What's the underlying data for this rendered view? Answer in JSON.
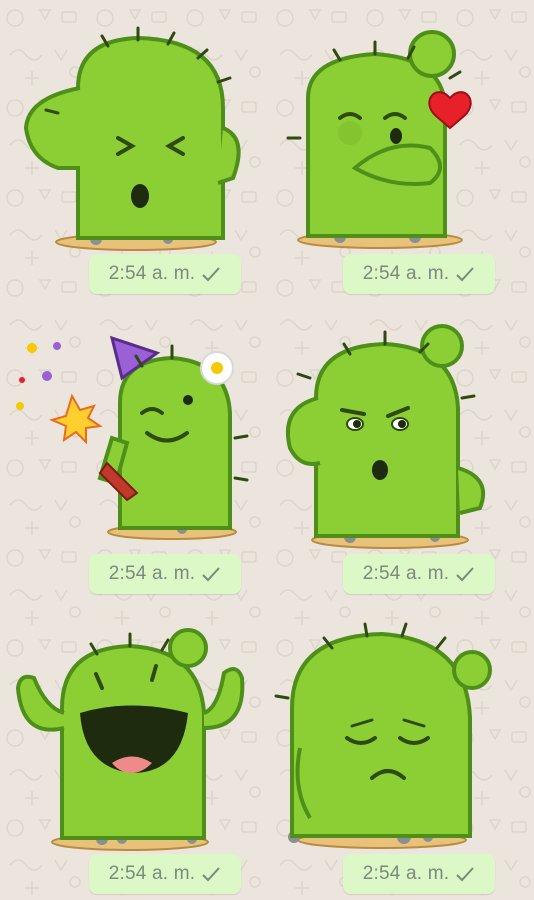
{
  "messages": [
    {
      "time": "2:54 a. m.",
      "status_icon": "single-check-icon",
      "sticker": "cactus-facepalm"
    },
    {
      "time": "2:54 a. m.",
      "status_icon": "single-check-icon",
      "sticker": "cactus-blowing-kiss"
    },
    {
      "time": "2:54 a. m.",
      "status_icon": "single-check-icon",
      "sticker": "cactus-party"
    },
    {
      "time": "2:54 a. m.",
      "status_icon": "single-check-icon",
      "sticker": "cactus-suspicious"
    },
    {
      "time": "2:54 a. m.",
      "status_icon": "single-check-icon",
      "sticker": "cactus-laughing"
    },
    {
      "time": "2:54 a. m.",
      "status_icon": "single-check-icon",
      "sticker": "cactus-sad"
    }
  ],
  "colors": {
    "chat_background": "#ece5dd",
    "bubble": "#dcf8c6",
    "cactus_green": "#8ccf35",
    "cactus_outline": "#4e8f1a",
    "meta_text": "#7b8a7b"
  }
}
